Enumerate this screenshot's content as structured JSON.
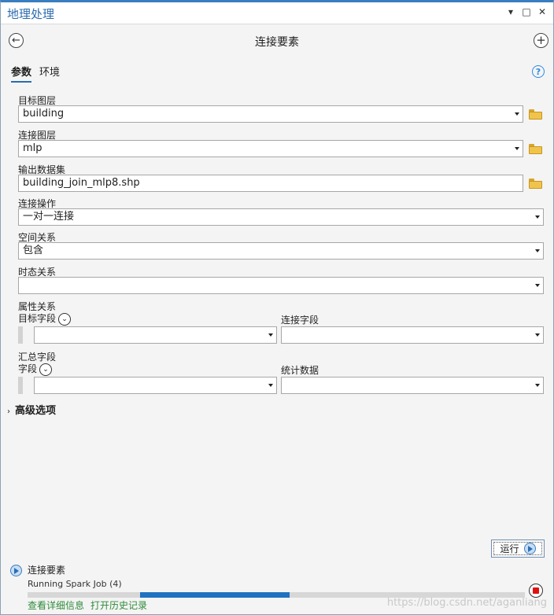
{
  "window": {
    "title": "地理处理",
    "controls": [
      "▾",
      "□",
      "✕"
    ]
  },
  "tool": {
    "name": "连接要素",
    "back_icon": "back-arrow-icon",
    "add_icon": "plus-icon"
  },
  "tabs": [
    {
      "label": "参数",
      "active": true
    },
    {
      "label": "环境",
      "active": false
    }
  ],
  "help_glyph": "?",
  "params": {
    "target_layer": {
      "label": "目标图层",
      "value": "building"
    },
    "join_layer": {
      "label": "连接图层",
      "value": "mlp"
    },
    "output": {
      "label": "输出数据集",
      "value": "building_join_mlp8.shp"
    },
    "join_operation": {
      "label": "连接操作",
      "value": "一对一连接"
    },
    "spatial_relationship": {
      "label": "空间关系",
      "value": "包含"
    },
    "temporal_relationship": {
      "label": "时态关系",
      "value": ""
    },
    "attribute_relationship": {
      "label": "属性关系",
      "target_field_label": "目标字段",
      "join_field_label": "连接字段",
      "target_field_value": "",
      "join_field_value": ""
    },
    "summary_fields": {
      "label": "汇总字段",
      "field_label": "字段",
      "statistic_label": "统计数据",
      "field_value": "",
      "statistic_value": ""
    }
  },
  "advanced": {
    "label": "高级选项",
    "glyph": "›"
  },
  "run_button": {
    "label": "运行"
  },
  "job": {
    "name": "连接要素",
    "status": "Running Spark Job (4)",
    "progress_start": 0.227,
    "progress_end": 0.527
  },
  "links": {
    "details": "查看详细信息",
    "history": "打开历史记录"
  },
  "watermark": "https://blog.csdn.net/aganliang",
  "colors": {
    "accent": "#2b6cb0",
    "progress": "#1f72c0",
    "link": "#2e8b3a",
    "stop": "#e01010",
    "folder": "#f0c44c"
  }
}
